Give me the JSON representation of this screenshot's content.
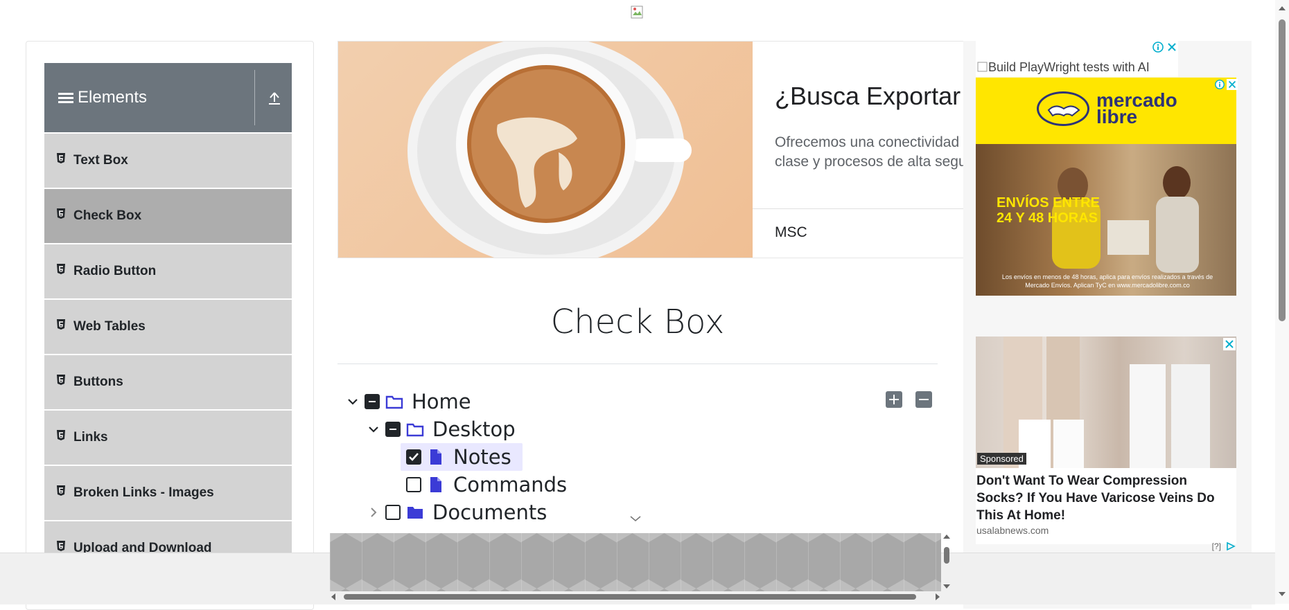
{
  "header": {
    "logo_alt": ""
  },
  "sidebar": {
    "group_title": "Elements",
    "items": [
      {
        "label": "Text Box",
        "active": false
      },
      {
        "label": "Check Box",
        "active": true
      },
      {
        "label": "Radio Button",
        "active": false
      },
      {
        "label": "Web Tables",
        "active": false
      },
      {
        "label": "Buttons",
        "active": false
      },
      {
        "label": "Links",
        "active": false
      },
      {
        "label": "Broken Links - Images",
        "active": false
      },
      {
        "label": "Upload and Download",
        "active": false
      }
    ]
  },
  "banner_ad": {
    "title": "¿Busca Exportar C",
    "description_line1": "Ofrecemos una conectividad",
    "description_line2": "clase y procesos de alta segu",
    "company": "MSC"
  },
  "main": {
    "title": "Check Box",
    "tree": [
      {
        "label": "Home",
        "state": "indeterminate",
        "expanded": true,
        "type": "folder"
      },
      {
        "label": "Desktop",
        "state": "indeterminate",
        "expanded": true,
        "type": "folder"
      },
      {
        "label": "Notes",
        "state": "checked",
        "type": "file"
      },
      {
        "label": "Commands",
        "state": "unchecked",
        "type": "file"
      },
      {
        "label": "Documents",
        "state": "unchecked",
        "expanded": false,
        "type": "folder"
      }
    ]
  },
  "right_ads": {
    "top_alt_text": "Build PlayWright tests with AI",
    "mercado": {
      "brand_line1": "mercado",
      "brand_line2": "libre",
      "promo_line1": "ENVÍOS ENTRE",
      "promo_line2": "24 Y 48 HORAS",
      "fine_print": "Los envíos en menos de 48 horas, aplica para envíos realizados a través de Mercado Envíos. Aplican TyC en www.mercadolibre.com.co"
    },
    "sponsored": {
      "badge": "Sponsored",
      "headline": "Don't Want To Wear Compression Socks? If You Have Varicose Veins Do This At Home!",
      "domain": "usalabnews.com",
      "info": "[?]"
    }
  },
  "colors": {
    "sidebar_header": "#6c757d",
    "menu_item": "#d3d3d3",
    "menu_item_active": "#adadad",
    "tree_icon": "#3b3bd6",
    "highlight": "#e9e8ff",
    "mercado_yellow": "#ffe600"
  }
}
